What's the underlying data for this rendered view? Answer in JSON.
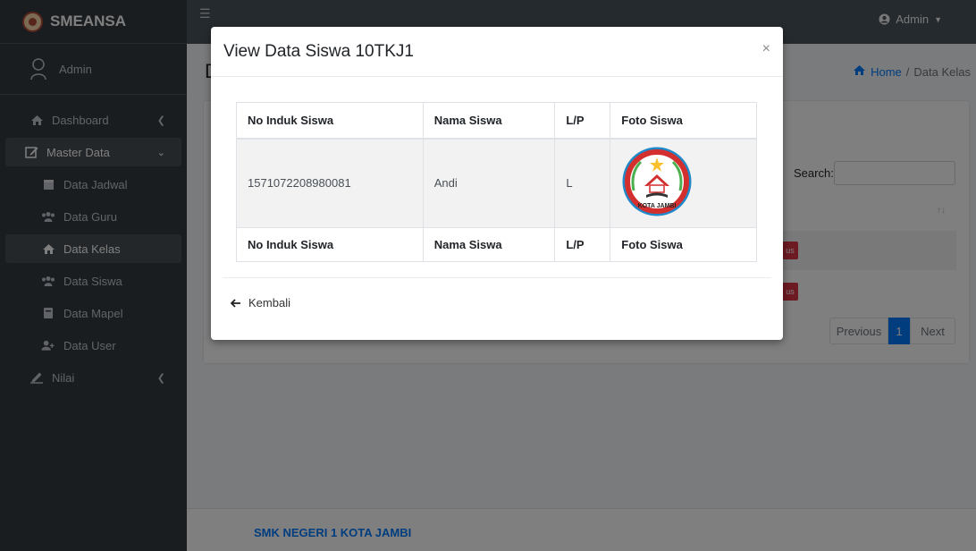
{
  "brand": {
    "name": "SMEANSA"
  },
  "user": {
    "name": "Admin"
  },
  "sidebar": {
    "items": [
      {
        "label": "Dashboard",
        "icon": "home-icon"
      },
      {
        "label": "Master Data",
        "icon": "edit-icon"
      },
      {
        "label": "Data Jadwal",
        "icon": "calendar-icon"
      },
      {
        "label": "Data Guru",
        "icon": "users-icon"
      },
      {
        "label": "Data Kelas",
        "icon": "home-icon"
      },
      {
        "label": "Data Siswa",
        "icon": "users-icon"
      },
      {
        "label": "Data Mapel",
        "icon": "book-icon"
      },
      {
        "label": "Data User",
        "icon": "user-plus-icon"
      },
      {
        "label": "Nilai",
        "icon": "signature-icon"
      }
    ]
  },
  "header": {
    "admin_label": "Admin"
  },
  "page": {
    "title": "D"
  },
  "breadcrumb": {
    "home": "Home",
    "separator": "/",
    "current": "Data Kelas"
  },
  "table_controls": {
    "search_label": "Search:",
    "sort_indicator": "↑↓",
    "delete_label": "us",
    "pagination": {
      "previous": "Previous",
      "current": "1",
      "next": "Next"
    }
  },
  "modal": {
    "title": "View Data Siswa 10TKJ1",
    "close": "×",
    "columns": [
      "No Induk Siswa",
      "Nama Siswa",
      "L/P",
      "Foto Siswa"
    ],
    "rows": [
      {
        "nis": "1571072208980081",
        "nama": "Andi",
        "lp": "L",
        "foto_logo_text": "KOTA JAMBI"
      }
    ],
    "back_label": "Kembali"
  },
  "footer": {
    "text": "SMK NEGERI 1 KOTA JAMBI"
  },
  "colors": {
    "sidebar_bg": "#343a40",
    "primary": "#007bff",
    "danger": "#dc3545"
  }
}
